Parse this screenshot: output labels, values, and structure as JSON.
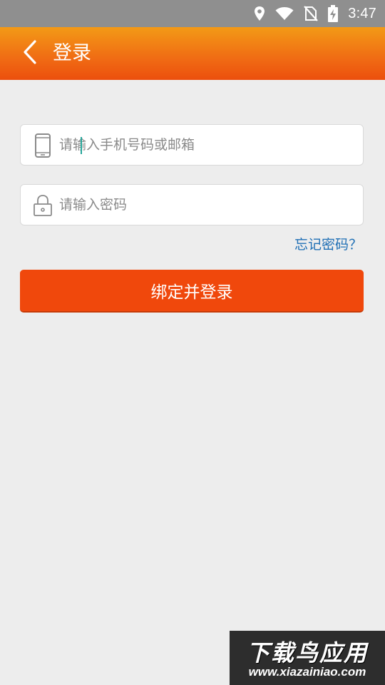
{
  "status_bar": {
    "time": "3:47",
    "icons": [
      "location-icon",
      "wifi-icon",
      "no-sim-icon",
      "battery-charging-icon"
    ]
  },
  "app_bar": {
    "back_icon": "chevron-left-icon",
    "title": "登录"
  },
  "form": {
    "account": {
      "icon": "phone-icon",
      "placeholder": "请输入手机号码或邮箱",
      "value": ""
    },
    "password": {
      "icon": "lock-icon",
      "placeholder": "请输入密码",
      "value": ""
    },
    "forgot_label": "忘记密码？",
    "submit_label": "绑定并登录"
  },
  "colors": {
    "header_top": "#f39a16",
    "header_bottom": "#ec4f0d",
    "button": "#f0480c",
    "link": "#1f6fb5",
    "background": "#ededed"
  },
  "watermark": {
    "title": "下载鸟应用",
    "url": "www.xiazainiao.com"
  }
}
